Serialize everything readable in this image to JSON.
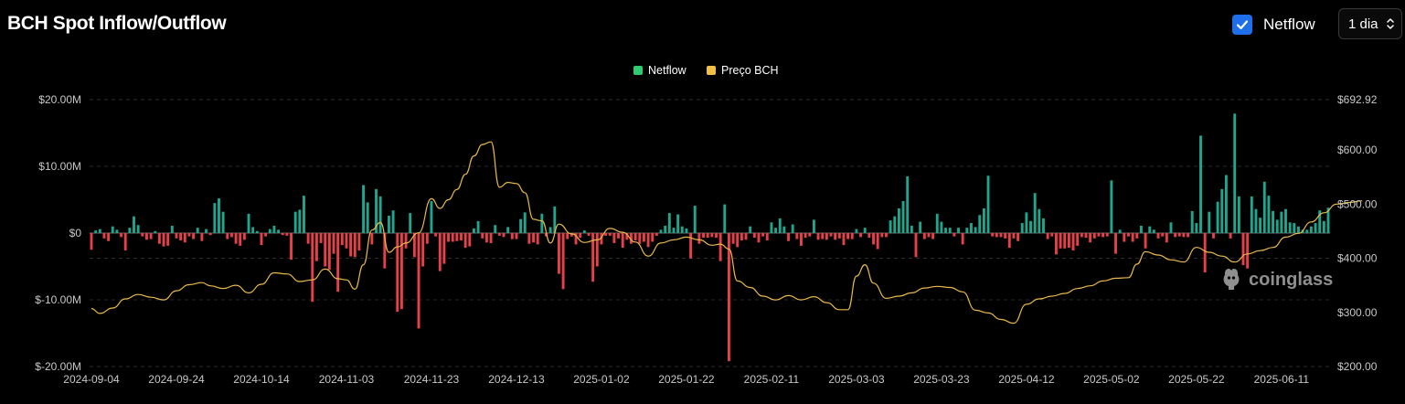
{
  "header": {
    "title": "BCH Spot Inflow/Outflow",
    "netflow_toggle_label": "Netflow",
    "interval_value": "1 dia"
  },
  "watermark": "coinglass",
  "colors": {
    "positive": "#1fa68f",
    "negative": "#e8404b",
    "price": "#e8b84a",
    "legend_netflow": "#2ecc71",
    "legend_price": "#f0c040",
    "grid": "#2a2a2a",
    "checkbox": "#1f6feb"
  },
  "chart_data": {
    "type": "bar",
    "legend": [
      "Netflow",
      "Preço BCH"
    ],
    "x_ticks": [
      "2024-09-04",
      "2024-09-24",
      "2024-10-14",
      "2024-11-03",
      "2024-11-23",
      "2024-12-13",
      "2025-01-02",
      "2025-01-22",
      "2025-02-11",
      "2025-03-03",
      "2025-03-23",
      "2025-04-12",
      "2025-05-02",
      "2025-05-22",
      "2025-06-11"
    ],
    "x_start": "2024-09-04",
    "x_tick_step_days": 20,
    "y_left": {
      "ticks": [
        "$20.00M",
        "$10.00M",
        "$0",
        "$-10.00M",
        "$-20.00M"
      ],
      "min": -20,
      "max": 20,
      "unit": "M USD"
    },
    "y_right": {
      "ticks": [
        "$692.92",
        "$600.00",
        "$500.00",
        "$400.00",
        "$300.00",
        "$200.00"
      ],
      "min": 200,
      "max": 692.92,
      "unit": "USD"
    },
    "series": [
      {
        "name": "Netflow",
        "kind": "bar",
        "values": [
          -2.5,
          0.4,
          0.6,
          -0.8,
          -1.2,
          1.0,
          0.5,
          -0.6,
          -2.6,
          0.8,
          2.5,
          1.2,
          -0.5,
          -1.0,
          -0.9,
          0.3,
          -1.6,
          -2.0,
          -1.9,
          1.1,
          -0.8,
          -1.1,
          -1.4,
          -0.5,
          -0.9,
          0.8,
          -1.2,
          0.6,
          -0.3,
          4.5,
          5.2,
          3.2,
          -0.9,
          -0.6,
          -1.6,
          -1.9,
          -1.0,
          2.9,
          0.9,
          0.3,
          -1.8,
          -0.5,
          0.6,
          1.1,
          0.5,
          -0.3,
          -0.4,
          -4.0,
          3.2,
          3.5,
          5.6,
          -1.6,
          -10.3,
          -4.2,
          -1.5,
          -5.0,
          -5.5,
          -3.1,
          -8.8,
          -1.8,
          -2.3,
          -3.5,
          -3.6,
          -2.6,
          7.2,
          4.6,
          -1.7,
          6.6,
          5.5,
          -5.3,
          2.6,
          3.4,
          -11.8,
          -11.4,
          -2.3,
          3.0,
          -3.6,
          -14.3,
          -5.0,
          -1.6,
          4.8,
          -0.5,
          -5.7,
          -4.6,
          -1.3,
          -1.3,
          -1.2,
          -1.1,
          -2.2,
          -2.0,
          0.7,
          1.8,
          -0.8,
          -1.4,
          -1.5,
          1.2,
          -0.4,
          -0.6,
          0.9,
          -0.9,
          -0.9,
          2.1,
          3.1,
          -1.6,
          -1.4,
          -1.7,
          2.9,
          -0.5,
          0.9,
          4.0,
          -6.1,
          -8.4,
          -0.9,
          -0.5,
          -1.7,
          -0.7,
          0.4,
          -0.4,
          -7.3,
          -5.0,
          -1.7,
          -0.4,
          -0.4,
          -1.5,
          -0.8,
          -2.2,
          -1.0,
          -1.6,
          -1.1,
          -1.6,
          -1.3,
          -2.1,
          -1.3,
          -0.4,
          0.5,
          1.1,
          3.0,
          0.8,
          2.8,
          1.0,
          0.7,
          -3.8,
          4.1,
          -1.6,
          -0.7,
          -0.7,
          -0.6,
          -0.7,
          -4.2,
          4.3,
          -19.2,
          -1.6,
          -2.1,
          -1.1,
          -1.0,
          1.0,
          -0.7,
          -1.4,
          -0.5,
          -1.1,
          1.6,
          0.8,
          2.2,
          1.0,
          -1.2,
          1.3,
          -0.9,
          -1.9,
          -0.7,
          -0.5,
          2.0,
          -1.0,
          -0.9,
          -1.0,
          -0.5,
          -1.0,
          -0.8,
          -1.8,
          -0.9,
          -0.9,
          0.6,
          -0.6,
          0.8,
          -0.7,
          -1.7,
          -2.4,
          -0.6,
          -0.6,
          1.9,
          2.5,
          3.7,
          4.8,
          8.5,
          1.1,
          -3.6,
          1.7,
          -0.9,
          -0.6,
          -0.9,
          2.9,
          1.7,
          0.8,
          0.8,
          -0.5,
          0.8,
          -1.7,
          0.8,
          1.5,
          0.9,
          2.7,
          3.7,
          8.6,
          -0.5,
          -0.6,
          -0.6,
          -0.8,
          -2.2,
          -0.8,
          -1.2,
          1.5,
          3.1,
          1.8,
          6.0,
          3.6,
          2.2,
          -0.9,
          -0.5,
          -3.2,
          -2.3,
          -2.3,
          -2.2,
          -2.6,
          -1.9,
          -0.6,
          -0.7,
          -1.4,
          -0.8,
          -0.5,
          -0.6,
          -0.5,
          7.9,
          -3.1,
          0.5,
          -1.3,
          -0.5,
          -1.3,
          -0.8,
          1.1,
          -2.3,
          1.0,
          0.5,
          -0.8,
          -0.5,
          -1.4,
          1.6,
          -0.6,
          -0.5,
          -0.6,
          -0.6,
          3.3,
          1.5,
          14.6,
          -5.9,
          3.2,
          -0.8,
          4.7,
          6.6,
          8.7,
          -0.8,
          17.9,
          5.5,
          -4.8,
          -5.3,
          5.5,
          3.6,
          2.3,
          7.7,
          5.6,
          3.3,
          2.0,
          3.2,
          3.6,
          1.6,
          1.5,
          1.0,
          0.5,
          0.5,
          1.0,
          1.5,
          3.4,
          1.8,
          3.8
        ]
      },
      {
        "name": "Preço BCH",
        "kind": "line",
        "points": [
          [
            "2024-09-04",
            307
          ],
          [
            "2024-09-06",
            298
          ],
          [
            "2024-09-09",
            308
          ],
          [
            "2024-09-12",
            325
          ],
          [
            "2024-09-15",
            333
          ],
          [
            "2024-09-18",
            328
          ],
          [
            "2024-09-21",
            323
          ],
          [
            "2024-09-24",
            340
          ],
          [
            "2024-09-27",
            351
          ],
          [
            "2024-09-30",
            355
          ],
          [
            "2024-10-02",
            349
          ],
          [
            "2024-10-05",
            344
          ],
          [
            "2024-10-08",
            350
          ],
          [
            "2024-10-11",
            336
          ],
          [
            "2024-10-14",
            352
          ],
          [
            "2024-10-17",
            373
          ],
          [
            "2024-10-20",
            371
          ],
          [
            "2024-10-23",
            357
          ],
          [
            "2024-10-26",
            360
          ],
          [
            "2024-10-29",
            380
          ],
          [
            "2024-11-01",
            362
          ],
          [
            "2024-11-03",
            360
          ],
          [
            "2024-11-05",
            343
          ],
          [
            "2024-11-07",
            388
          ],
          [
            "2024-11-09",
            452
          ],
          [
            "2024-11-11",
            466
          ],
          [
            "2024-11-13",
            411
          ],
          [
            "2024-11-15",
            421
          ],
          [
            "2024-11-17",
            428
          ],
          [
            "2024-11-20",
            447
          ],
          [
            "2024-11-23",
            510
          ],
          [
            "2024-11-25",
            492
          ],
          [
            "2024-11-27",
            508
          ],
          [
            "2024-11-29",
            527
          ],
          [
            "2024-12-01",
            555
          ],
          [
            "2024-12-03",
            589
          ],
          [
            "2024-12-05",
            610
          ],
          [
            "2024-12-07",
            615
          ],
          [
            "2024-12-09",
            531
          ],
          [
            "2024-12-11",
            540
          ],
          [
            "2024-12-13",
            538
          ],
          [
            "2024-12-15",
            521
          ],
          [
            "2024-12-17",
            472
          ],
          [
            "2024-12-19",
            469
          ],
          [
            "2024-12-21",
            428
          ],
          [
            "2024-12-23",
            463
          ],
          [
            "2024-12-26",
            445
          ],
          [
            "2024-12-29",
            429
          ],
          [
            "2025-01-01",
            434
          ],
          [
            "2025-01-04",
            455
          ],
          [
            "2025-01-07",
            448
          ],
          [
            "2025-01-10",
            430
          ],
          [
            "2025-01-13",
            404
          ],
          [
            "2025-01-16",
            428
          ],
          [
            "2025-01-19",
            434
          ],
          [
            "2025-01-22",
            439
          ],
          [
            "2025-01-25",
            434
          ],
          [
            "2025-01-28",
            424
          ],
          [
            "2025-01-30",
            426
          ],
          [
            "2025-02-01",
            417
          ],
          [
            "2025-02-03",
            358
          ],
          [
            "2025-02-06",
            346
          ],
          [
            "2025-02-09",
            330
          ],
          [
            "2025-02-12",
            323
          ],
          [
            "2025-02-15",
            331
          ],
          [
            "2025-02-18",
            323
          ],
          [
            "2025-02-21",
            329
          ],
          [
            "2025-02-24",
            318
          ],
          [
            "2025-02-27",
            305
          ],
          [
            "2025-03-01",
            305
          ],
          [
            "2025-03-03",
            367
          ],
          [
            "2025-03-05",
            388
          ],
          [
            "2025-03-07",
            354
          ],
          [
            "2025-03-10",
            326
          ],
          [
            "2025-03-13",
            330
          ],
          [
            "2025-03-16",
            336
          ],
          [
            "2025-03-19",
            345
          ],
          [
            "2025-03-22",
            348
          ],
          [
            "2025-03-25",
            346
          ],
          [
            "2025-03-28",
            338
          ],
          [
            "2025-03-31",
            304
          ],
          [
            "2025-04-03",
            299
          ],
          [
            "2025-04-06",
            287
          ],
          [
            "2025-04-09",
            280
          ],
          [
            "2025-04-12",
            315
          ],
          [
            "2025-04-15",
            325
          ],
          [
            "2025-04-18",
            330
          ],
          [
            "2025-04-21",
            335
          ],
          [
            "2025-04-24",
            344
          ],
          [
            "2025-04-27",
            349
          ],
          [
            "2025-04-30",
            358
          ],
          [
            "2025-05-03",
            363
          ],
          [
            "2025-05-06",
            364
          ],
          [
            "2025-05-08",
            389
          ],
          [
            "2025-05-10",
            412
          ],
          [
            "2025-05-13",
            406
          ],
          [
            "2025-05-16",
            397
          ],
          [
            "2025-05-19",
            393
          ],
          [
            "2025-05-22",
            420
          ],
          [
            "2025-05-25",
            411
          ],
          [
            "2025-05-28",
            404
          ],
          [
            "2025-05-31",
            393
          ],
          [
            "2025-06-03",
            408
          ],
          [
            "2025-06-06",
            414
          ],
          [
            "2025-06-09",
            420
          ],
          [
            "2025-06-12",
            439
          ],
          [
            "2025-06-15",
            446
          ],
          [
            "2025-06-18",
            467
          ],
          [
            "2025-06-21",
            484
          ],
          [
            "2025-06-24",
            500
          ],
          [
            "2025-06-27",
            503
          ],
          [
            "2025-06-30",
            506
          ]
        ]
      }
    ]
  }
}
